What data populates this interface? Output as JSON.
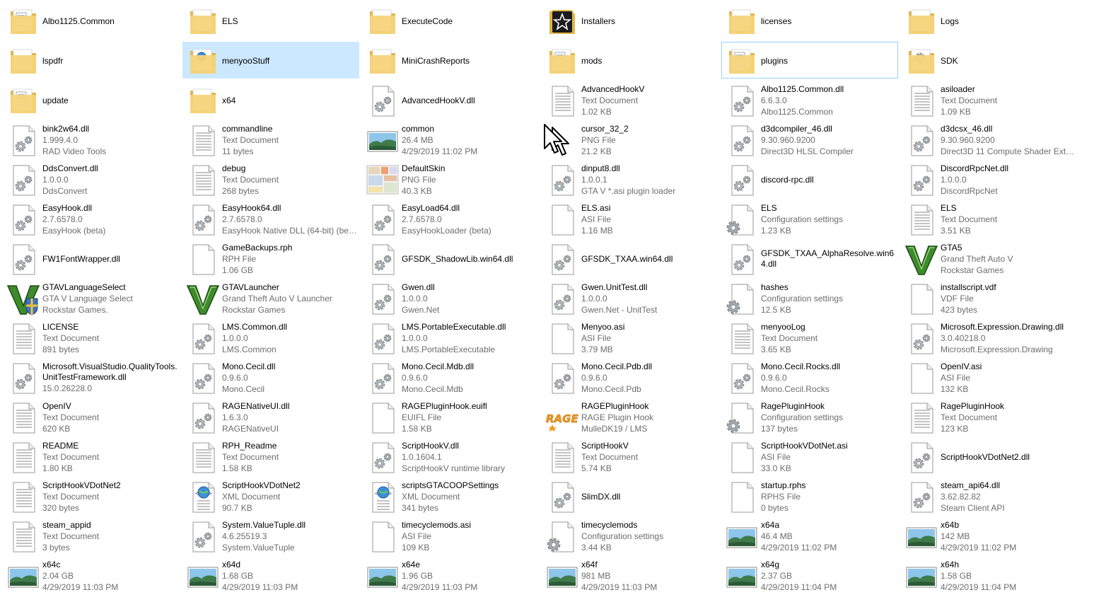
{
  "items": [
    {
      "name": "Albo1125.Common",
      "icon": "folder-doc-icon"
    },
    {
      "name": "ELS",
      "icon": "folder-icon"
    },
    {
      "name": "ExecuteCode",
      "icon": "folder-icon"
    },
    {
      "name": "Installers",
      "icon": "installers-star-icon"
    },
    {
      "name": "licenses",
      "icon": "folder-icon"
    },
    {
      "name": "Logs",
      "icon": "folder-icon"
    },
    {
      "name": "lspdfr",
      "icon": "folder-icon"
    },
    {
      "name": "menyooStuff",
      "icon": "folder-globe-icon",
      "selected": true
    },
    {
      "name": "MiniCrashReports",
      "icon": "folder-icon"
    },
    {
      "name": "mods",
      "icon": "folder-doc-icon"
    },
    {
      "name": "plugins",
      "icon": "folder-doc-icon",
      "hover": true
    },
    {
      "name": "SDK",
      "icon": "folder-gear-icon"
    },
    {
      "name": "update",
      "icon": "folder-doc-icon"
    },
    {
      "name": "x64",
      "icon": "folder-icon"
    },
    {
      "name": "AdvancedHookV.dll",
      "icon": "dll-gear-icon"
    },
    {
      "name": "AdvancedHookV",
      "sub1": "Text Document",
      "sub2": "1.02 KB",
      "icon": "text-doc-icon"
    },
    {
      "name": "Albo1125.Common.dll",
      "sub1": "6.6.3.0",
      "sub2": "Albo1125.Common",
      "icon": "dll-gear-icon"
    },
    {
      "name": "asiloader",
      "sub1": "Text Document",
      "sub2": "1.09 KB",
      "icon": "text-doc-icon"
    },
    {
      "name": "bink2w64.dll",
      "sub1": "1.999.4.0",
      "sub2": "RAD Video Tools",
      "icon": "dll-gear-icon"
    },
    {
      "name": "commandline",
      "sub1": "Text Document",
      "sub2": "11 bytes",
      "icon": "text-doc-icon"
    },
    {
      "name": "common",
      "sub1": "26.4 MB",
      "sub2": "4/29/2019 11:02 PM",
      "icon": "image-landscape-icon"
    },
    {
      "name": "cursor_32_2",
      "sub1": "PNG File",
      "sub2": "21.2 KB",
      "icon": "cursor-png-icon"
    },
    {
      "name": "d3dcompiler_46.dll",
      "sub1": "9.30.960.9200",
      "sub2": "Direct3D HLSL Compiler",
      "icon": "dll-gear-icon"
    },
    {
      "name": "d3dcsx_46.dll",
      "sub1": "9.30.960.9200",
      "sub2": "Direct3D 11 Compute Shader Exte...",
      "icon": "dll-gear-icon"
    },
    {
      "name": "DdsConvert.dll",
      "sub1": "1.0.0.0",
      "sub2": "DdsConvert",
      "icon": "dll-gear-icon"
    },
    {
      "name": "debug",
      "sub1": "Text Document",
      "sub2": "268 bytes",
      "icon": "text-doc-icon"
    },
    {
      "name": "DefaultSkin",
      "sub1": "PNG File",
      "sub2": "40.3 KB",
      "icon": "skin-png-icon"
    },
    {
      "name": "dinput8.dll",
      "sub1": "1.0.0.1",
      "sub2": "GTA V *.asi plugin loader",
      "icon": "dll-gear-icon"
    },
    {
      "name": "discord-rpc.dll",
      "icon": "dll-gear-icon"
    },
    {
      "name": "DiscordRpcNet.dll",
      "sub1": "1.0.0.0",
      "sub2": "DiscordRpcNet",
      "icon": "dll-gear-icon"
    },
    {
      "name": "EasyHook.dll",
      "sub1": "2.7.6578.0",
      "sub2": "EasyHook (beta)",
      "icon": "dll-gear-icon"
    },
    {
      "name": "EasyHook64.dll",
      "sub1": "2.7.6578.0",
      "sub2": "EasyHook Native DLL (64-bit) (bet...",
      "icon": "dll-gear-icon"
    },
    {
      "name": "EasyLoad64.dll",
      "sub1": "2.7.6578.0",
      "sub2": "EasyHookLoader (beta)",
      "icon": "dll-gear-icon"
    },
    {
      "name": "ELS.asi",
      "sub1": "ASI File",
      "sub2": "1.16 MB",
      "icon": "blank-file-icon"
    },
    {
      "name": "ELS",
      "sub1": "Configuration settings",
      "sub2": "1.23 KB",
      "icon": "config-gear-icon"
    },
    {
      "name": "ELS",
      "sub1": "Text Document",
      "sub2": "3.51 KB",
      "icon": "text-doc-icon"
    },
    {
      "name": "FW1FontWrapper.dll",
      "icon": "dll-gear-icon"
    },
    {
      "name": "GameBackups.rph",
      "sub1": "RPH File",
      "sub2": "1.06 GB",
      "icon": "blank-file-icon"
    },
    {
      "name": "GFSDK_ShadowLib.win64.dll",
      "icon": "dll-gear-icon"
    },
    {
      "name": "GFSDK_TXAA.win64.dll",
      "icon": "dll-gear-icon"
    },
    {
      "name": "GFSDK_TXAA_AlphaResolve.win64.dll",
      "icon": "dll-gear-icon",
      "wrap": true
    },
    {
      "name": "GTA5",
      "sub1": "Grand Theft Auto V",
      "sub2": "Rockstar Games",
      "icon": "gta-v-logo-icon"
    },
    {
      "name": "GTAVLanguageSelect",
      "sub1": "GTA V Language Select",
      "sub2": "Rockstar Games.",
      "icon": "gta-v-shield-icon"
    },
    {
      "name": "GTAVLauncher",
      "sub1": "Grand Theft Auto V Launcher",
      "sub2": "Rockstar Games",
      "icon": "gta-v-logo-icon"
    },
    {
      "name": "Gwen.dll",
      "sub1": "1.0.0.0",
      "sub2": "Gwen.Net",
      "icon": "dll-gear-icon"
    },
    {
      "name": "Gwen.UnitTest.dll",
      "sub1": "1.0.0.0",
      "sub2": "Gwen.Net - UnitTest",
      "icon": "dll-gear-icon"
    },
    {
      "name": "hashes",
      "sub1": "Configuration settings",
      "sub2": "12.5 KB",
      "icon": "config-gear-icon"
    },
    {
      "name": "installscript.vdf",
      "sub1": "VDF File",
      "sub2": "423 bytes",
      "icon": "blank-file-icon"
    },
    {
      "name": "LICENSE",
      "sub1": "Text Document",
      "sub2": "891 bytes",
      "icon": "text-doc-icon"
    },
    {
      "name": "LMS.Common.dll",
      "sub1": "1.0.0.0",
      "sub2": "LMS.Common",
      "icon": "dll-gear-icon"
    },
    {
      "name": "LMS.PortableExecutable.dll",
      "sub1": "1.0.0.0",
      "sub2": "LMS.PortableExecutable",
      "icon": "dll-gear-icon"
    },
    {
      "name": "Menyoo.asi",
      "sub1": "ASI File",
      "sub2": "3.79 MB",
      "icon": "blank-file-icon"
    },
    {
      "name": "menyooLog",
      "sub1": "Text Document",
      "sub2": "3.65 KB",
      "icon": "text-doc-icon"
    },
    {
      "name": "Microsoft.Expression.Drawing.dll",
      "sub1": "3.0.40218.0",
      "sub2": "Microsoft.Expression.Drawing",
      "icon": "dll-gear-icon"
    },
    {
      "name": "Microsoft.VisualStudio.QualityTools.UnitTestFramework.dll",
      "sub1": "15.0.26228.0",
      "icon": "dll-gear-icon",
      "wrap": true
    },
    {
      "name": "Mono.Cecil.dll",
      "sub1": "0.9.6.0",
      "sub2": "Mono.Cecil",
      "icon": "dll-gear-icon"
    },
    {
      "name": "Mono.Cecil.Mdb.dll",
      "sub1": "0.9.6.0",
      "sub2": "Mono.Cecil.Mdb",
      "icon": "dll-gear-icon"
    },
    {
      "name": "Mono.Cecil.Pdb.dll",
      "sub1": "0.9.6.0",
      "sub2": "Mono.Cecil.Pdb",
      "icon": "dll-gear-icon"
    },
    {
      "name": "Mono.Cecil.Rocks.dll",
      "sub1": "0.9.6.0",
      "sub2": "Mono.Cecil.Rocks",
      "icon": "dll-gear-icon"
    },
    {
      "name": "OpenIV.asi",
      "sub1": "ASI File",
      "sub2": "132 KB",
      "icon": "blank-file-icon"
    },
    {
      "name": "OpenIV",
      "sub1": "Text Document",
      "sub2": "620 KB",
      "icon": "text-doc-icon"
    },
    {
      "name": "RAGENativeUI.dll",
      "sub1": "1.6.3.0",
      "sub2": "RAGENativeUI",
      "icon": "dll-gear-icon"
    },
    {
      "name": "RAGEPluginHook.euifl",
      "sub1": "EUIFL File",
      "sub2": "1.58 KB",
      "icon": "blank-file-icon"
    },
    {
      "name": "RAGEPluginHook",
      "sub1": "RAGE Plugin Hook",
      "sub2": "MulleDK19 / LMS",
      "icon": "rage-logo-icon"
    },
    {
      "name": "RagePluginHook",
      "sub1": "Configuration settings",
      "sub2": "137 bytes",
      "icon": "config-gear-icon"
    },
    {
      "name": "RagePluginHook",
      "sub1": "Text Document",
      "sub2": "123 KB",
      "icon": "text-doc-icon"
    },
    {
      "name": "README",
      "sub1": "Text Document",
      "sub2": "1.80 KB",
      "icon": "text-doc-icon"
    },
    {
      "name": "RPH_Readme",
      "sub1": "Text Document",
      "sub2": "1.58 KB",
      "icon": "text-doc-icon"
    },
    {
      "name": "ScriptHookV.dll",
      "sub1": "1.0.1604.1",
      "sub2": "ScriptHookV runtime library",
      "icon": "dll-gear-icon"
    },
    {
      "name": "ScriptHookV",
      "sub1": "Text Document",
      "sub2": "5.74 KB",
      "icon": "text-doc-icon"
    },
    {
      "name": "ScriptHookVDotNet.asi",
      "sub1": "ASI File",
      "sub2": "33.0 KB",
      "icon": "blank-file-icon"
    },
    {
      "name": "ScriptHookVDotNet2.dll",
      "icon": "dll-gear-icon"
    },
    {
      "name": "ScriptHookVDotNet2",
      "sub1": "Text Document",
      "sub2": "320 bytes",
      "icon": "text-doc-icon"
    },
    {
      "name": "ScriptHookVDotNet2",
      "sub1": "XML Document",
      "sub2": "90.7 KB",
      "icon": "xml-globe-icon"
    },
    {
      "name": "scriptsGTACOOPSettings",
      "sub1": "XML Document",
      "sub2": "341 bytes",
      "icon": "xml-globe-icon"
    },
    {
      "name": "SlimDX.dll",
      "icon": "dll-gear-icon"
    },
    {
      "name": "startup.rphs",
      "sub1": "RPHS File",
      "sub2": "0 bytes",
      "icon": "blank-file-icon"
    },
    {
      "name": "steam_api64.dll",
      "sub1": "3.62.82.82",
      "sub2": "Steam Client API",
      "icon": "dll-gear-icon"
    },
    {
      "name": "steam_appid",
      "sub1": "Text Document",
      "sub2": "3 bytes",
      "icon": "text-doc-icon"
    },
    {
      "name": "System.ValueTuple.dll",
      "sub1": "4.6.25519.3",
      "sub2": "System.ValueTuple",
      "icon": "dll-gear-icon"
    },
    {
      "name": "timecyclemods.asi",
      "sub1": "ASI File",
      "sub2": "109 KB",
      "icon": "blank-file-icon"
    },
    {
      "name": "timecyclemods",
      "sub1": "Configuration settings",
      "sub2": "3.44 KB",
      "icon": "config-gear-icon"
    },
    {
      "name": "x64a",
      "sub1": "46.4 MB",
      "sub2": "4/29/2019 11:02 PM",
      "icon": "image-landscape-icon"
    },
    {
      "name": "x64b",
      "sub1": "142 MB",
      "sub2": "4/29/2019 11:02 PM",
      "icon": "image-landscape-icon"
    },
    {
      "name": "x64c",
      "sub1": "2.04 GB",
      "sub2": "4/29/2019 11:03 PM",
      "icon": "image-landscape-icon"
    },
    {
      "name": "x64d",
      "sub1": "1.68 GB",
      "sub2": "4/29/2019 11:03 PM",
      "icon": "image-landscape-icon"
    },
    {
      "name": "x64e",
      "sub1": "1.96 GB",
      "sub2": "4/29/2019 11:03 PM",
      "icon": "image-landscape-icon"
    },
    {
      "name": "x64f",
      "sub1": "981 MB",
      "sub2": "4/29/2019 11:03 PM",
      "icon": "image-landscape-icon"
    },
    {
      "name": "x64g",
      "sub1": "2.37 GB",
      "sub2": "4/29/2019 11:04 PM",
      "icon": "image-landscape-icon"
    },
    {
      "name": "x64h",
      "sub1": "1.58 GB",
      "sub2": "4/29/2019 11:04 PM",
      "icon": "image-landscape-icon"
    }
  ],
  "colors": {
    "folder": "#f5d47a",
    "folder_dark": "#e2b54a",
    "selection": "#cce8ff",
    "hover_border": "#99d1ff",
    "subtext": "#6d6d6d",
    "gta_green": "#3e8b2c",
    "rage_orange": "#f39a1b"
  },
  "mouse_cursor": {
    "icon": "mouse-pointer-icon"
  }
}
